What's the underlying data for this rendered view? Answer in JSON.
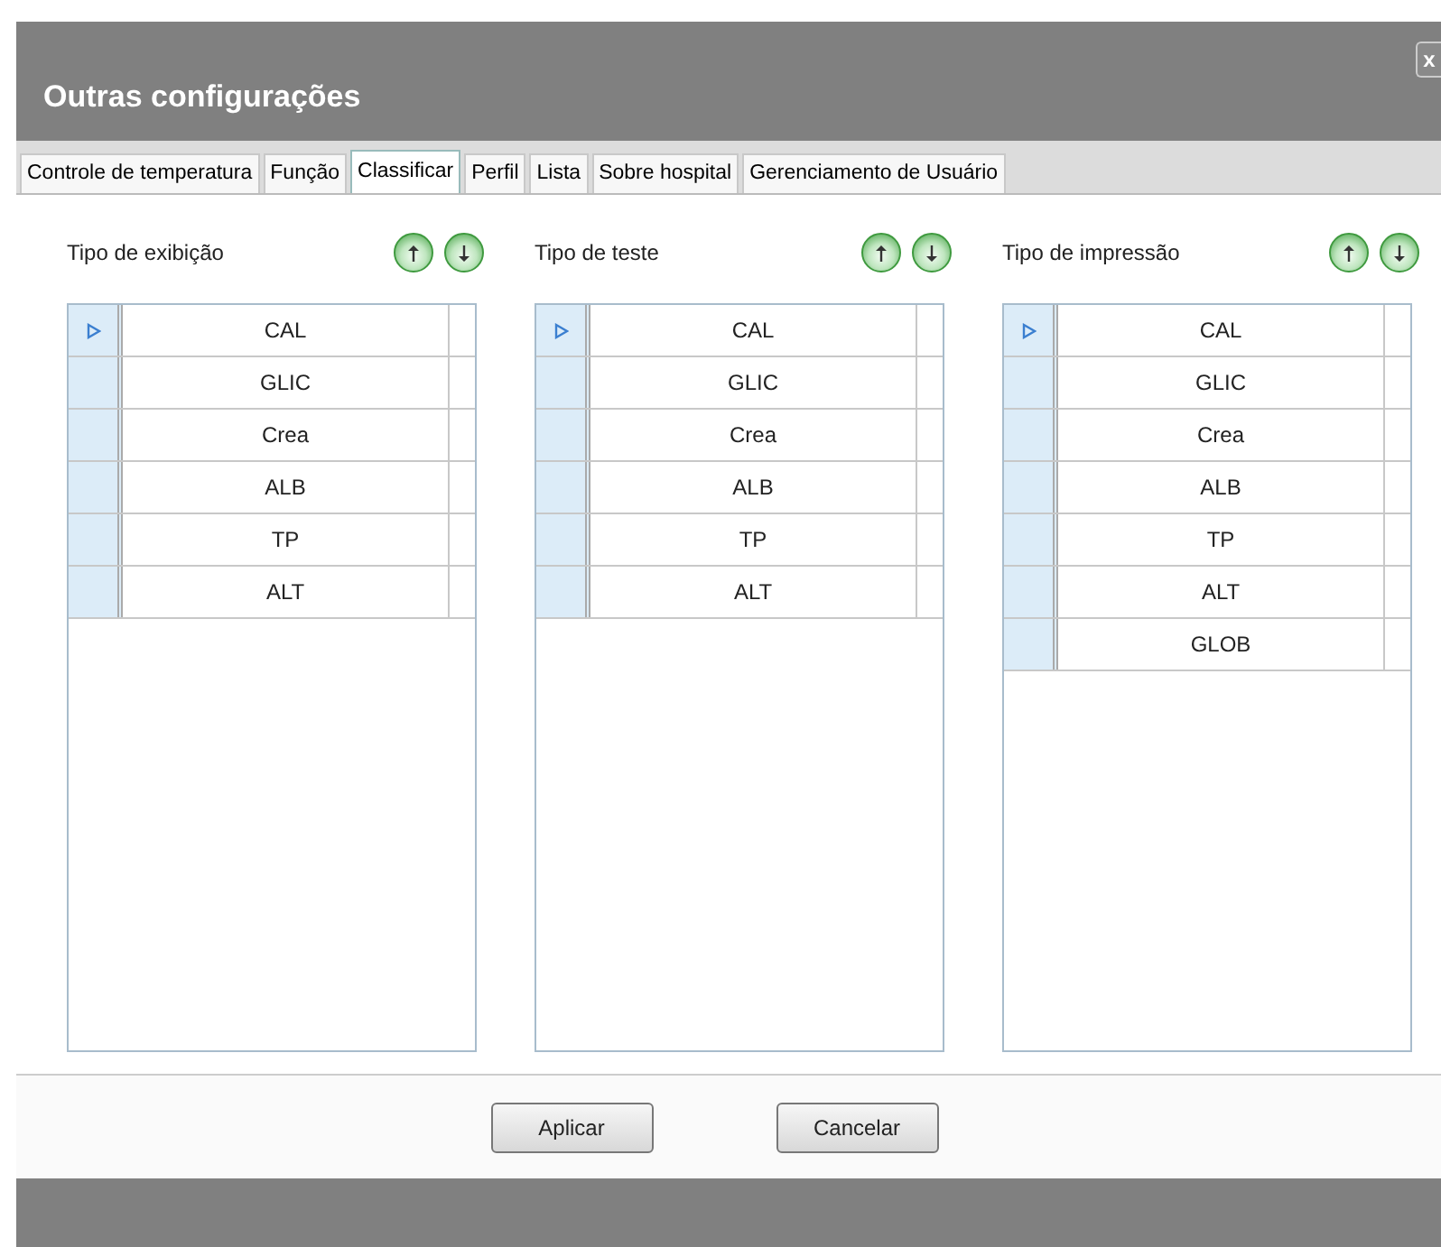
{
  "window": {
    "title": "Outras configurações",
    "close_label": "x"
  },
  "tabs": [
    {
      "label": "Controle de temperatura",
      "selected": false
    },
    {
      "label": "Função",
      "selected": false
    },
    {
      "label": "Classificar",
      "selected": true
    },
    {
      "label": "Perfil",
      "selected": false
    },
    {
      "label": "Lista",
      "selected": false
    },
    {
      "label": "Sobre hospital",
      "selected": false
    },
    {
      "label": "Gerenciamento de Usuário",
      "selected": false
    }
  ],
  "lists": [
    {
      "title": "Tipo de exibição",
      "rows": [
        {
          "name": "CAL",
          "current": true
        },
        {
          "name": "GLIC",
          "current": false
        },
        {
          "name": "Crea",
          "current": false
        },
        {
          "name": "ALB",
          "current": false
        },
        {
          "name": "TP",
          "current": false
        },
        {
          "name": "ALT",
          "current": false
        }
      ]
    },
    {
      "title": "Tipo de teste",
      "rows": [
        {
          "name": "CAL",
          "current": true
        },
        {
          "name": "GLIC",
          "current": false
        },
        {
          "name": "Crea",
          "current": false
        },
        {
          "name": "ALB",
          "current": false
        },
        {
          "name": "TP",
          "current": false
        },
        {
          "name": "ALT",
          "current": false
        }
      ]
    },
    {
      "title": "Tipo de impressão",
      "rows": [
        {
          "name": "CAL",
          "current": true
        },
        {
          "name": "GLIC",
          "current": false
        },
        {
          "name": "Crea",
          "current": false
        },
        {
          "name": "ALB",
          "current": false
        },
        {
          "name": "TP",
          "current": false
        },
        {
          "name": "ALT",
          "current": false
        },
        {
          "name": "GLOB",
          "current": false
        }
      ]
    }
  ],
  "buttons": [
    "Aplicar",
    "Cancelar"
  ]
}
